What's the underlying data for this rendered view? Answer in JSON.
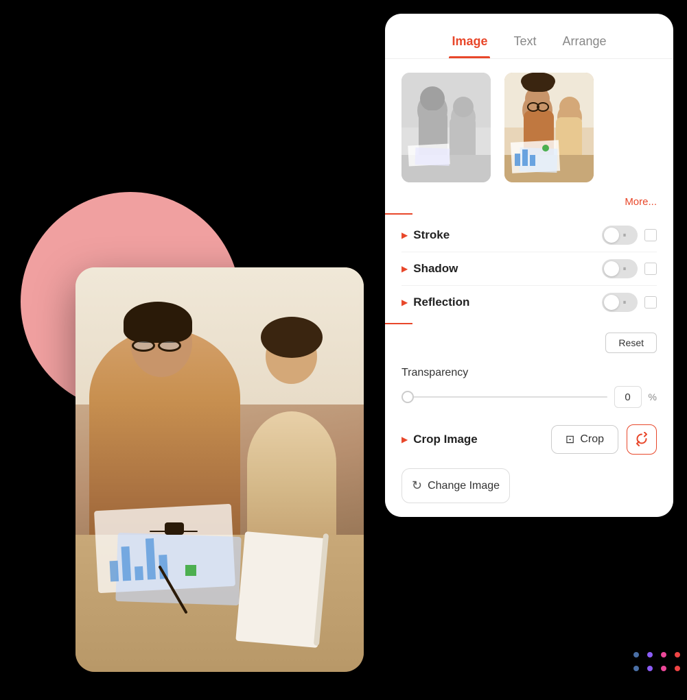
{
  "background": "#000000",
  "panel": {
    "tabs": [
      {
        "id": "image",
        "label": "Image",
        "active": true
      },
      {
        "id": "text",
        "label": "Text",
        "active": false
      },
      {
        "id": "arrange",
        "label": "Arrange",
        "active": false
      }
    ],
    "more_label": "More...",
    "effects": [
      {
        "id": "stroke",
        "label": "Stroke"
      },
      {
        "id": "shadow",
        "label": "Shadow"
      },
      {
        "id": "reflection",
        "label": "Reflection"
      }
    ],
    "reset_label": "Reset",
    "transparency": {
      "label": "Transparency",
      "value": "0",
      "percent": "%"
    },
    "crop_image": {
      "label": "Crop Image",
      "crop_btn_label": "Crop",
      "icon": "✂"
    },
    "change_image": {
      "label": "Change Image",
      "icon": "↻"
    }
  },
  "dots": {
    "rows": [
      [
        "blue",
        "purple",
        "pink",
        "red"
      ],
      [
        "blue",
        "purple",
        "pink",
        "red"
      ]
    ]
  }
}
